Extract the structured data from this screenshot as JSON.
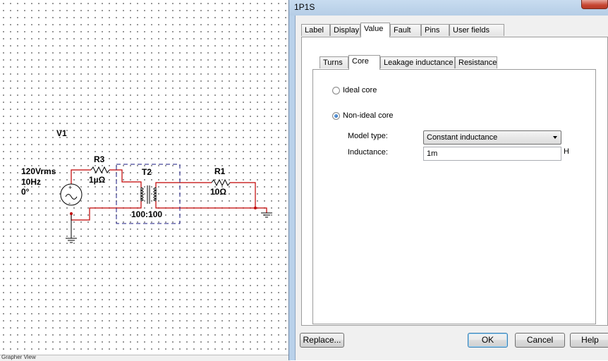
{
  "dialog": {
    "title": "1P1S",
    "tabs": [
      {
        "label": "Label"
      },
      {
        "label": "Display"
      },
      {
        "label": "Value"
      },
      {
        "label": "Fault"
      },
      {
        "label": "Pins"
      },
      {
        "label": "User fields"
      }
    ],
    "active_tab": "Value",
    "subtabs": [
      {
        "label": "Turns"
      },
      {
        "label": "Core"
      },
      {
        "label": "Leakage inductance"
      },
      {
        "label": "Resistance"
      }
    ],
    "active_subtab": "Core",
    "core": {
      "ideal_label": "Ideal core",
      "nonideal_label": "Non-ideal core",
      "selected": "Non-ideal core",
      "model_type_label": "Model type:",
      "model_type_value": "Constant inductance",
      "inductance_label": "Inductance:",
      "inductance_value": "1m",
      "inductance_unit": "H"
    },
    "buttons": {
      "replace": "Replace...",
      "ok": "OK",
      "cancel": "Cancel",
      "help": "Help"
    }
  },
  "schematic": {
    "source_name": "V1",
    "source_voltage": "120Vrms",
    "source_freq": "10Hz",
    "source_phase": "0°",
    "r3_name": "R3",
    "r3_value": "1µΩ",
    "transformer_name": "T2",
    "transformer_ratio": "100:100",
    "r1_name": "R1",
    "r1_value": "10Ω",
    "wire_color": "#c00000",
    "box_color": "#1a1a80"
  },
  "statusbar": {
    "text": "Grapher View"
  }
}
